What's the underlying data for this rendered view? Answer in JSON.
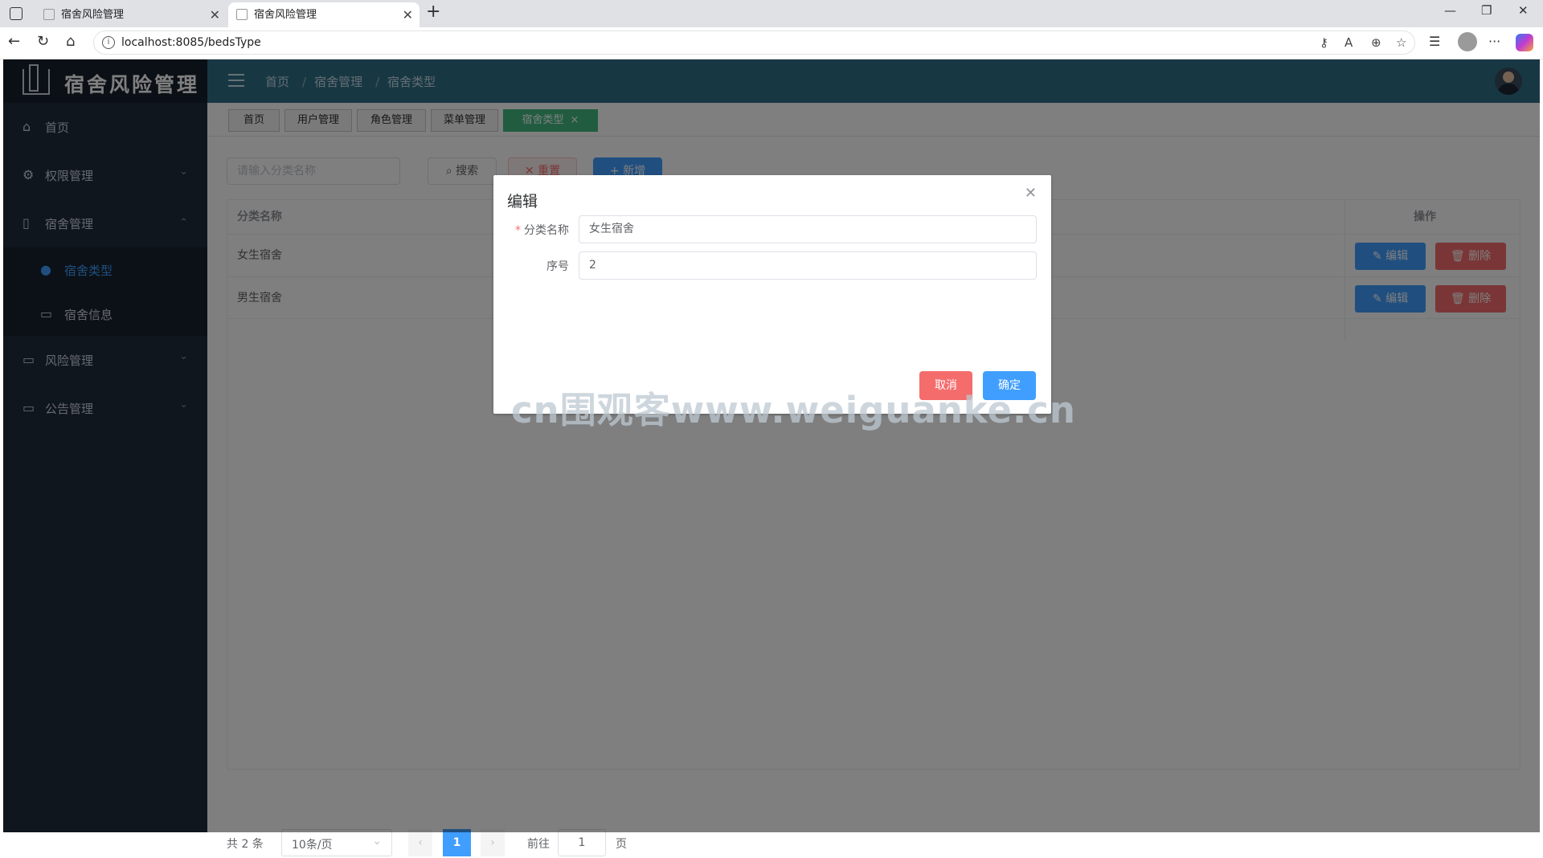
{
  "browser": {
    "tabs": [
      {
        "title": "宿舍风险管理"
      },
      {
        "title": "宿舍风险管理"
      }
    ],
    "url": "localhost:8085/bedsType"
  },
  "app": {
    "logo_text": "宿舍风险管理",
    "menu": [
      {
        "label": "首页",
        "icon": "home-icon"
      },
      {
        "label": "权限管理",
        "icon": "gear-icon"
      },
      {
        "label": "宿舍管理",
        "icon": "document-icon"
      },
      {
        "label": "风险管理",
        "icon": "folder-icon"
      },
      {
        "label": "公告管理",
        "icon": "folder-icon"
      }
    ],
    "submenu": [
      {
        "label": "宿舍类型",
        "icon": "user-icon",
        "active": true
      },
      {
        "label": "宿舍信息",
        "icon": "folder-icon",
        "active": false
      }
    ],
    "breadcrumb": [
      "首页",
      "宿舍管理",
      "宿舍类型"
    ],
    "breadcrumb_sep": "/",
    "tags": [
      "首页",
      "用户管理",
      "角色管理",
      "菜单管理",
      "宿舍类型"
    ],
    "tag_close": "×"
  },
  "toolbar": {
    "search_placeholder": "请输入分类名称",
    "search_label": "搜索",
    "reset_label": "重置",
    "add_label": "新增"
  },
  "table": {
    "headers": [
      "分类名称",
      "操作"
    ],
    "rows": [
      {
        "name": "女生宿舍"
      },
      {
        "name": "男生宿舍"
      }
    ],
    "edit_label": "编辑",
    "delete_label": "删除"
  },
  "pager": {
    "total": "共 2 条",
    "page_size": "10条/页",
    "current_page": "1",
    "goto_label": "前往",
    "goto_value": "1",
    "page_suffix": "页"
  },
  "dialog": {
    "title": "编辑",
    "name_label": "分类名称",
    "name_value": "女生宿舍",
    "order_label": "序号",
    "order_value": "2",
    "cancel_label": "取消",
    "ok_label": "确定"
  },
  "watermark": "cn围观客www.weiguanke.cn",
  "colors": {
    "sidebar": "#1f2d3d",
    "header": "#2f6f86",
    "primary": "#409eff",
    "danger": "#f56c6c",
    "active_tag": "#42b983"
  }
}
